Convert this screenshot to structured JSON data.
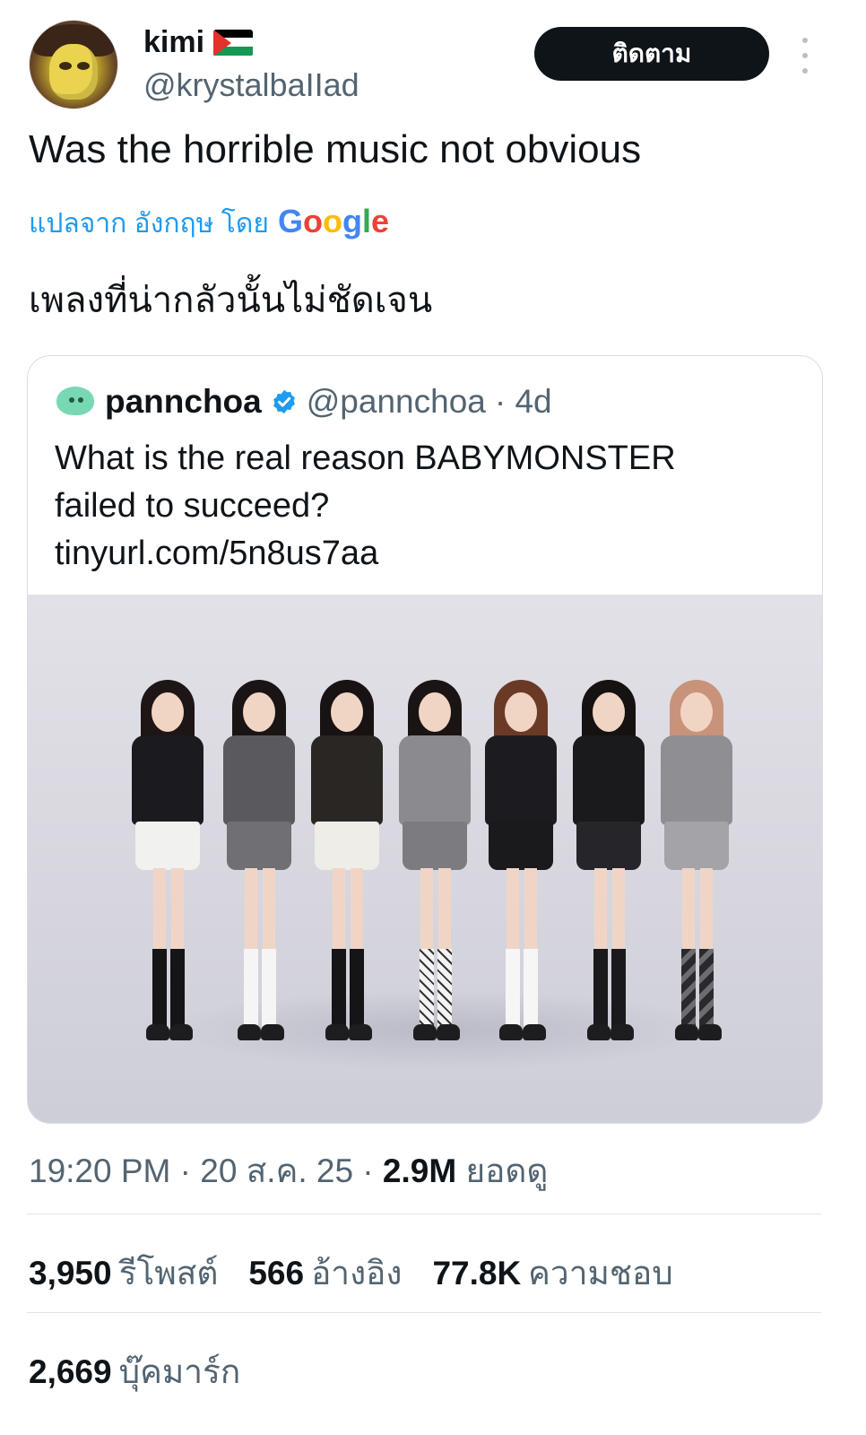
{
  "author": {
    "display_name": "kimi",
    "handle": "@krystalbaIIad",
    "flag_icon": "palestine-flag-icon"
  },
  "actions": {
    "follow_label": "ติดตาม",
    "more_icon": "more-vertical-icon"
  },
  "tweet": {
    "text": "Was the horrible music not obvious",
    "translate_label": "แปลจาก อังกฤษ โดย",
    "translate_provider": "Google",
    "translated_text": "เพลงที่น่ากลัวนั้นไม่ชัดเจน"
  },
  "quote": {
    "name": "pannchoa",
    "verified_icon": "verified-badge-icon",
    "handle": "@pannchoa",
    "age": "· 4d",
    "line1": "What is the real reason BABYMONSTER",
    "line2": "failed to succeed?",
    "link": "tinyurl.com/5n8us7aa",
    "image": "group-photo"
  },
  "meta": {
    "time": "19:20 PM",
    "sep1": " · ",
    "date": "20 ส.ค. 25",
    "sep2": " · ",
    "views_count": "2.9M",
    "views_label": "ยอดดู"
  },
  "stats": {
    "reposts_count": "3,950",
    "reposts_label": "รีโพสต์",
    "quotes_count": "566",
    "quotes_label": "อ้างอิง",
    "likes_count": "77.8K",
    "likes_label": "ความชอบ",
    "bookmarks_count": "2,669",
    "bookmarks_label": "บุ๊คมาร์ก"
  },
  "colors": {
    "link_blue": "#1d9bf0",
    "follow_bg": "#0f1419",
    "secondary_text": "#536471",
    "verified_blue": "#1d9bf0"
  }
}
